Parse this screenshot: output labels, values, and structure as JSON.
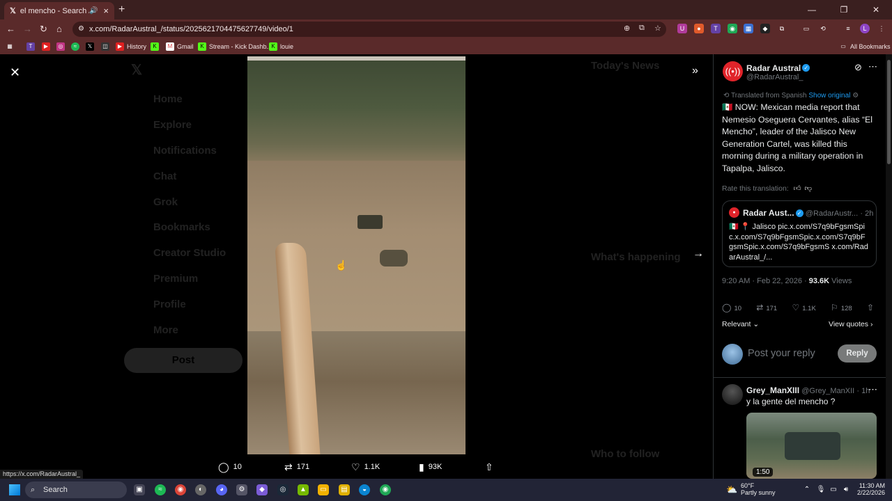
{
  "browser": {
    "tab_title": "el mencho - Search / X",
    "tab_icon": "x-logo-icon",
    "url": "x.com/RadarAustral_/status/2025621704475627749/video/1",
    "bookmarks": [
      "History",
      "Gmail",
      "Stream - Kick Dashb...",
      "louie"
    ],
    "all_bookmarks": "All Bookmarks",
    "status_url": "https://x.com/RadarAustral_"
  },
  "background_page": {
    "nav": [
      "Home",
      "Explore",
      "Notifications",
      "Chat",
      "Grok",
      "Bookmarks",
      "Creator Studio",
      "Premium",
      "Profile",
      "More"
    ],
    "post_button": "Post",
    "todays_news": "Today's News",
    "whats_happening": "What's happening",
    "who_to_follow": "Who to follow"
  },
  "video": {
    "stats": {
      "replies": "10",
      "reposts": "171",
      "likes": "1.1K",
      "views": "93K"
    }
  },
  "post": {
    "author_name": "Radar Austral",
    "author_handle": "@RadarAustral_",
    "translated_from": "Translated from Spanish",
    "show_original": "Show original",
    "text": "🇲🇽 NOW: Mexican media report that Nemesio Oseguera Cervantes, alias “El Mencho”, leader of the Jalisco New Generation Cartel, was killed this morning during a military operation in Tapalpa, Jalisco.",
    "rate_translation": "Rate this translation:",
    "quote": {
      "name": "Radar Aust...",
      "handle": "@RadarAustr...",
      "time": "· 2h",
      "text": "🇲🇽 📍 Jalisco pic.x.com/S7q9bFgsmSpic.x.com/S7q9bFgsmSpic.x.com/S7q9bFgsmSpic.x.com/S7q9bFgsmS x.com/RadarAustral_/..."
    },
    "timestamp": "9:20 AM · Feb 22, 2026 ·",
    "views_count": "93.6K",
    "views_label": "Views",
    "actions": {
      "replies": "10",
      "reposts": "171",
      "likes": "1.1K",
      "bookmarks": "128"
    },
    "relevant": "Relevant",
    "view_quotes": "View quotes",
    "reply_placeholder": "Post your reply",
    "reply_button": "Reply"
  },
  "reply": {
    "name": "Grey_ManXIII",
    "handle": "@Grey_ManXII",
    "time": "· 1h",
    "text": "y la gente del mencho ?",
    "video_duration": "1:50"
  },
  "taskbar": {
    "search": "Search",
    "weather_temp": "60°F",
    "weather_desc": "Partly sunny",
    "time": "11:30 AM",
    "date": "2/22/2026"
  }
}
